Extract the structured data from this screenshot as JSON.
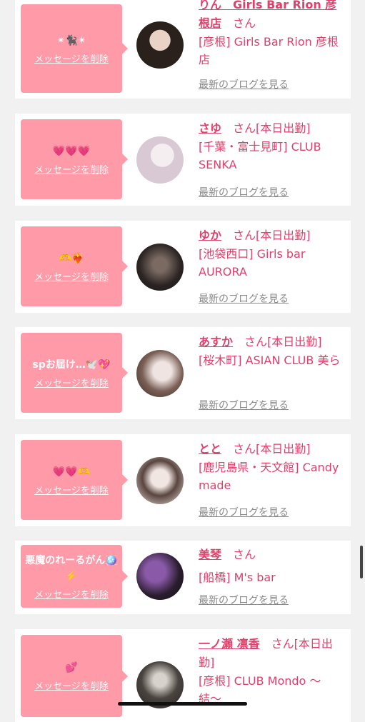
{
  "cards": [
    {
      "message": "✴︎🐈‍⬛✴︎",
      "name": "りん　Girls Bar Rion 彦根店",
      "san": "さん",
      "shop": "[彦根] Girls Bar Rion 彦根店"
    },
    {
      "message": "💗💗💗",
      "name": "さゆ",
      "san": "さん[本日出勤]",
      "shop": "[千葉・富士見町] CLUB SENKA"
    },
    {
      "message": "🫶❤️‍🔥",
      "name": "ゆか",
      "san": "さん[本日出勤]",
      "shop": "[池袋西口] Girls bar AURORA"
    },
    {
      "message": "spお届け…🕊️💖",
      "name": "あすか",
      "san": "さん[本日出勤]",
      "shop": "[桜木町] ASIAN CLUB 美ら"
    },
    {
      "message": "💗💗🫶",
      "name": "とと",
      "san": "さん[本日出勤]",
      "shop": "[鹿児島県・天文館] Candy made"
    },
    {
      "message": "悪魔のれーるがん🪩⚡️",
      "name": "美琴",
      "san": "さん",
      "shop": "[船橋] M's bar"
    },
    {
      "message": "💕",
      "name": "一ノ瀬 凛香",
      "san": "さん[本日出勤]",
      "shop": "[彦根] CLUB Mondo 〜結〜"
    }
  ],
  "labels": {
    "delete": "メッセージを削除",
    "blog": "最新のブログを見る"
  },
  "colors": {
    "accent": "#e0406a",
    "bubble": "#ff9aa8",
    "muted": "#8a8a8a"
  }
}
